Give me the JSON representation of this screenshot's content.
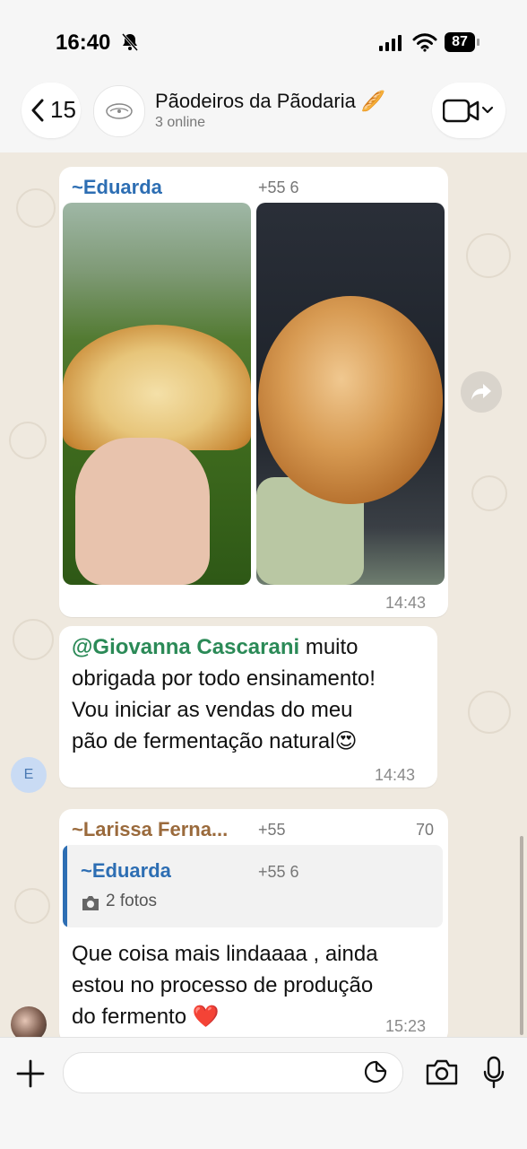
{
  "status": {
    "time": "16:40",
    "battery": "87"
  },
  "header": {
    "back_count": "15",
    "group_name": "Pãodeiros da Pãodaria 🥖",
    "subtitle": "3 online"
  },
  "messages": [
    {
      "sender": "~Eduarda",
      "phone": "+55 6",
      "type": "photos",
      "time": "14:43"
    },
    {
      "mention": "@Giovanna Cascarani",
      "text_after_mention": " muito",
      "lines": [
        "obrigada por todo ensinamento!",
        "Vou iniciar as vendas do meu",
        "pão de fermentação natural😍"
      ],
      "time": "14:43",
      "avatar_letter": "E"
    },
    {
      "sender": "~Larissa Ferna...",
      "phone": "+55",
      "phone_tail": "70",
      "quote": {
        "sender": "~Eduarda",
        "phone": "+55 6",
        "text": "2 fotos"
      },
      "lines": [
        "Que coisa mais lindaaaa , ainda",
        "estou no processo de produção",
        "do fermento ❤️"
      ],
      "time": "15:23"
    }
  ],
  "composer": {
    "placeholder": ""
  }
}
